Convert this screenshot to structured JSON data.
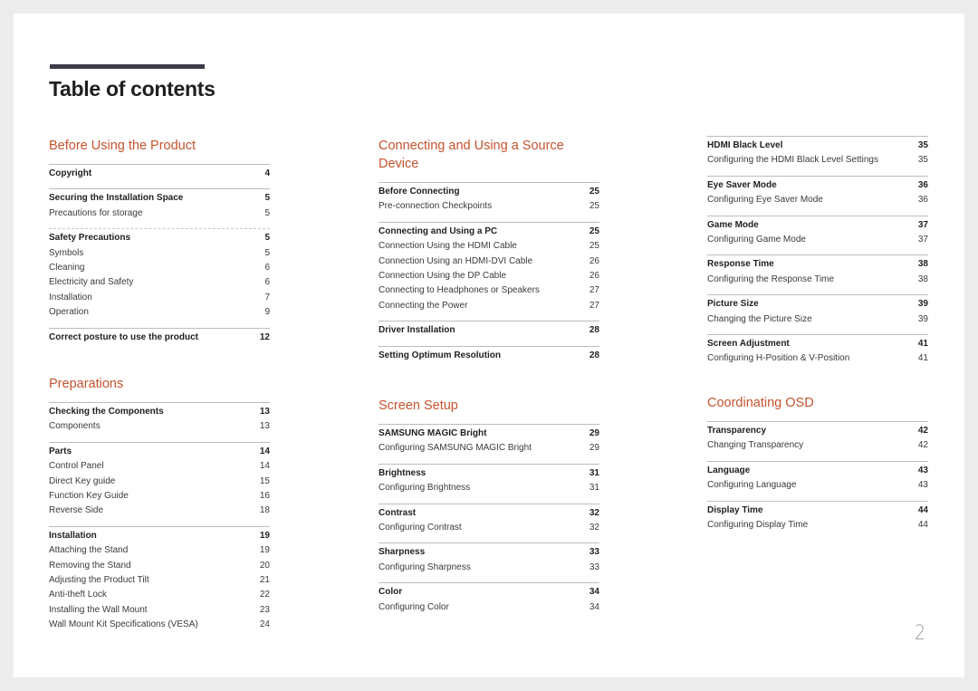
{
  "page": {
    "title": "Table of contents",
    "page_number": "2",
    "accent_color": "#c4532e",
    "title_bar_color": "#3d3c4a"
  },
  "sections": {
    "before_using": {
      "title": "Before Using the Product",
      "groups": [
        {
          "head": {
            "label": "Copyright",
            "page": "4"
          },
          "items": []
        },
        {
          "head": {
            "label": "Securing the Installation Space",
            "page": "5"
          },
          "items": [
            {
              "label": "Precautions for storage",
              "page": "5"
            }
          ]
        },
        {
          "head": {
            "label": "Safety Precautions",
            "page": "5"
          },
          "items": [
            {
              "label": "Symbols",
              "page": "5"
            },
            {
              "label": "Cleaning",
              "page": "6"
            },
            {
              "label": "Electricity and Safety",
              "page": "6"
            },
            {
              "label": "Installation",
              "page": "7"
            },
            {
              "label": "Operation",
              "page": "9"
            }
          ]
        },
        {
          "head": {
            "label": "Correct posture to use the product",
            "page": "12"
          },
          "items": []
        }
      ]
    },
    "preparations": {
      "title": "Preparations",
      "groups": [
        {
          "head": {
            "label": "Checking the Components",
            "page": "13"
          },
          "items": [
            {
              "label": "Components",
              "page": "13"
            }
          ]
        },
        {
          "head": {
            "label": "Parts",
            "page": "14"
          },
          "items": [
            {
              "label": "Control Panel",
              "page": "14"
            },
            {
              "label": "Direct Key guide",
              "page": "15"
            },
            {
              "label": "Function Key Guide",
              "page": "16"
            },
            {
              "label": "Reverse Side",
              "page": "18"
            }
          ]
        },
        {
          "head": {
            "label": "Installation",
            "page": "19"
          },
          "items": [
            {
              "label": "Attaching the Stand",
              "page": "19"
            },
            {
              "label": "Removing the Stand",
              "page": "20"
            },
            {
              "label": "Adjusting the Product Tilt",
              "page": "21"
            },
            {
              "label": "Anti-theft Lock",
              "page": "22"
            },
            {
              "label": "Installing the Wall Mount",
              "page": "23"
            },
            {
              "label": "Wall Mount Kit Specifications (VESA)",
              "page": "24"
            }
          ]
        }
      ]
    },
    "connecting": {
      "title": "Connecting and Using a Source Device",
      "groups": [
        {
          "head": {
            "label": "Before Connecting",
            "page": "25"
          },
          "items": [
            {
              "label": "Pre-connection Checkpoints",
              "page": "25"
            }
          ]
        },
        {
          "head": {
            "label": "Connecting and Using a PC",
            "page": "25"
          },
          "items": [
            {
              "label": "Connection Using the HDMI Cable",
              "page": "25"
            },
            {
              "label": "Connection Using an HDMI-DVI Cable",
              "page": "26"
            },
            {
              "label": "Connection Using the DP Cable",
              "page": "26"
            },
            {
              "label": "Connecting to Headphones or Speakers",
              "page": "27"
            },
            {
              "label": "Connecting the Power",
              "page": "27"
            }
          ]
        },
        {
          "head": {
            "label": "Driver Installation",
            "page": "28"
          },
          "items": []
        },
        {
          "head": {
            "label": "Setting Optimum Resolution",
            "page": "28"
          },
          "items": []
        }
      ]
    },
    "screen_setup": {
      "title": "Screen Setup",
      "groups": [
        {
          "head": {
            "label": "SAMSUNG MAGIC Bright",
            "page": "29"
          },
          "items": [
            {
              "label": "Configuring SAMSUNG MAGIC Bright",
              "page": "29"
            }
          ]
        },
        {
          "head": {
            "label": "Brightness",
            "page": "31"
          },
          "items": [
            {
              "label": "Configuring Brightness",
              "page": "31"
            }
          ]
        },
        {
          "head": {
            "label": "Contrast",
            "page": "32"
          },
          "items": [
            {
              "label": "Configuring Contrast",
              "page": "32"
            }
          ]
        },
        {
          "head": {
            "label": "Sharpness",
            "page": "33"
          },
          "items": [
            {
              "label": "Configuring Sharpness",
              "page": "33"
            }
          ]
        },
        {
          "head": {
            "label": "Color",
            "page": "34"
          },
          "items": [
            {
              "label": "Configuring Color",
              "page": "34"
            }
          ]
        }
      ]
    },
    "screen_setup_cont": {
      "groups": [
        {
          "head": {
            "label": "HDMI Black Level",
            "page": "35"
          },
          "items": [
            {
              "label": "Configuring the HDMI Black Level Settings",
              "page": "35"
            }
          ]
        },
        {
          "head": {
            "label": "Eye Saver Mode",
            "page": "36"
          },
          "items": [
            {
              "label": "Configuring Eye Saver Mode",
              "page": "36"
            }
          ]
        },
        {
          "head": {
            "label": "Game Mode",
            "page": "37"
          },
          "items": [
            {
              "label": "Configuring Game Mode",
              "page": "37"
            }
          ]
        },
        {
          "head": {
            "label": "Response Time",
            "page": "38"
          },
          "items": [
            {
              "label": "Configuring the Response Time",
              "page": "38"
            }
          ]
        },
        {
          "head": {
            "label": "Picture Size",
            "page": "39"
          },
          "items": [
            {
              "label": "Changing the Picture Size",
              "page": "39"
            }
          ]
        },
        {
          "head": {
            "label": "Screen Adjustment",
            "page": "41"
          },
          "items": [
            {
              "label": "Configuring H-Position & V-Position",
              "page": "41"
            }
          ]
        }
      ]
    },
    "coordinating_osd": {
      "title": "Coordinating OSD",
      "groups": [
        {
          "head": {
            "label": "Transparency",
            "page": "42"
          },
          "items": [
            {
              "label": "Changing Transparency",
              "page": "42"
            }
          ]
        },
        {
          "head": {
            "label": "Language",
            "page": "43"
          },
          "items": [
            {
              "label": "Configuring Language",
              "page": "43"
            }
          ]
        },
        {
          "head": {
            "label": "Display Time",
            "page": "44"
          },
          "items": [
            {
              "label": "Configuring Display Time",
              "page": "44"
            }
          ]
        }
      ]
    }
  }
}
